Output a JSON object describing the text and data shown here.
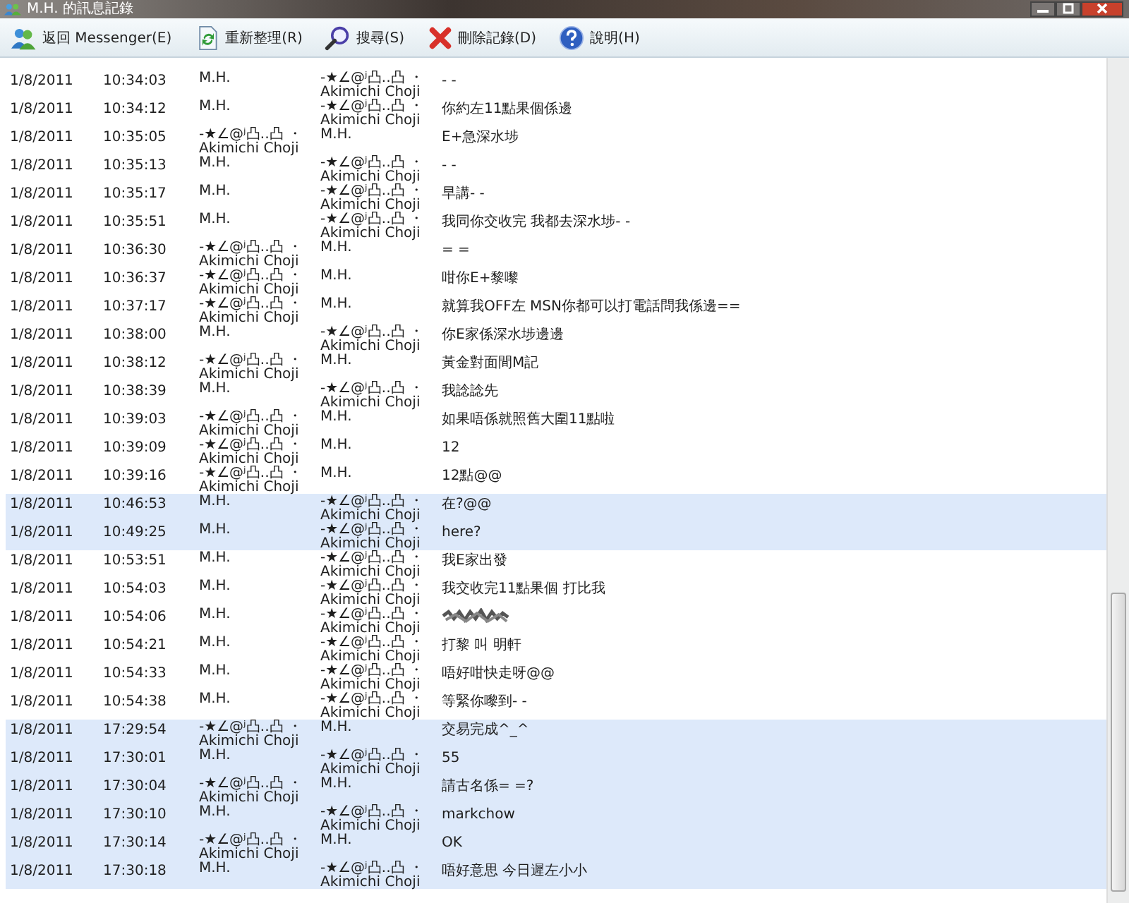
{
  "window": {
    "title": "M.H. 的訊息記錄"
  },
  "toolbar": [
    {
      "kind": "back",
      "label": "返回 Messenger(E)"
    },
    {
      "kind": "refresh",
      "label": "重新整理(R)"
    },
    {
      "kind": "search",
      "label": "搜尋(S)"
    },
    {
      "kind": "delete",
      "label": "刪除記錄(D)"
    },
    {
      "kind": "help",
      "label": "說明(H)"
    }
  ],
  "rows": [
    {
      "date": "1/8/2011",
      "time": "10:34:03",
      "from": "M.H.",
      "to": "-★∠@ʲ凸‥凸 ・ Akimichi Choji",
      "message": "- -",
      "selected": false
    },
    {
      "date": "1/8/2011",
      "time": "10:34:12",
      "from": "M.H.",
      "to": "-★∠@ʲ凸‥凸 ・ Akimichi Choji",
      "message": "你約左11點果個係邊",
      "selected": false
    },
    {
      "date": "1/8/2011",
      "time": "10:35:05",
      "from": "-★∠@ʲ凸‥凸 ・ Akimichi Choji",
      "to": "M.H.",
      "message": "E+急深水埗",
      "selected": false
    },
    {
      "date": "1/8/2011",
      "time": "10:35:13",
      "from": "M.H.",
      "to": "-★∠@ʲ凸‥凸 ・ Akimichi Choji",
      "message": "- -",
      "selected": false
    },
    {
      "date": "1/8/2011",
      "time": "10:35:17",
      "from": "M.H.",
      "to": "-★∠@ʲ凸‥凸 ・ Akimichi Choji",
      "message": "早講- -",
      "selected": false
    },
    {
      "date": "1/8/2011",
      "time": "10:35:51",
      "from": "M.H.",
      "to": "-★∠@ʲ凸‥凸 ・ Akimichi Choji",
      "message": "我同你交收完 我都去深水埗- -",
      "selected": false
    },
    {
      "date": "1/8/2011",
      "time": "10:36:30",
      "from": "-★∠@ʲ凸‥凸 ・ Akimichi Choji",
      "to": "M.H.",
      "message": "= =",
      "selected": false
    },
    {
      "date": "1/8/2011",
      "time": "10:36:37",
      "from": "-★∠@ʲ凸‥凸 ・ Akimichi Choji",
      "to": "M.H.",
      "message": "咁你E+黎嚟",
      "selected": false
    },
    {
      "date": "1/8/2011",
      "time": "10:37:17",
      "from": "-★∠@ʲ凸‥凸 ・ Akimichi Choji",
      "to": "M.H.",
      "message": "就算我OFF左 MSN你都可以打電話問我係邊==",
      "selected": false
    },
    {
      "date": "1/8/2011",
      "time": "10:38:00",
      "from": "M.H.",
      "to": "-★∠@ʲ凸‥凸 ・ Akimichi Choji",
      "message": "你E家係深水埗邊邊",
      "selected": false
    },
    {
      "date": "1/8/2011",
      "time": "10:38:12",
      "from": "-★∠@ʲ凸‥凸 ・ Akimichi Choji",
      "to": "M.H.",
      "message": "黃金對面間M記",
      "selected": false
    },
    {
      "date": "1/8/2011",
      "time": "10:38:39",
      "from": "M.H.",
      "to": "-★∠@ʲ凸‥凸 ・ Akimichi Choji",
      "message": "我諗諗先",
      "selected": false
    },
    {
      "date": "1/8/2011",
      "time": "10:39:03",
      "from": "-★∠@ʲ凸‥凸 ・ Akimichi Choji",
      "to": "M.H.",
      "message": "如果唔係就照舊大圍11點啦",
      "selected": false
    },
    {
      "date": "1/8/2011",
      "time": "10:39:09",
      "from": "-★∠@ʲ凸‥凸 ・ Akimichi Choji",
      "to": "M.H.",
      "message": "12",
      "selected": false
    },
    {
      "date": "1/8/2011",
      "time": "10:39:16",
      "from": "-★∠@ʲ凸‥凸 ・ Akimichi Choji",
      "to": "M.H.",
      "message": "12點@@",
      "selected": false
    },
    {
      "date": "1/8/2011",
      "time": "10:46:53",
      "from": "M.H.",
      "to": "-★∠@ʲ凸‥凸 ・ Akimichi Choji",
      "message": "在?@@",
      "selected": true
    },
    {
      "date": "1/8/2011",
      "time": "10:49:25",
      "from": "M.H.",
      "to": "-★∠@ʲ凸‥凸 ・ Akimichi Choji",
      "message": "here?",
      "selected": true
    },
    {
      "date": "1/8/2011",
      "time": "10:53:51",
      "from": "M.H.",
      "to": "-★∠@ʲ凸‥凸 ・ Akimichi Choji",
      "message": "我E家出發",
      "selected": false
    },
    {
      "date": "1/8/2011",
      "time": "10:54:03",
      "from": "M.H.",
      "to": "-★∠@ʲ凸‥凸 ・ Akimichi Choji",
      "message": "我交收完11點果個 打比我",
      "selected": false
    },
    {
      "date": "1/8/2011",
      "time": "10:54:06",
      "from": "M.H.",
      "to": "-★∠@ʲ凸‥凸 ・ Akimichi Choji",
      "redacted": true,
      "selected": false
    },
    {
      "date": "1/8/2011",
      "time": "10:54:21",
      "from": "M.H.",
      "to": "-★∠@ʲ凸‥凸 ・ Akimichi Choji",
      "message": "打黎 叫 明軒",
      "selected": false
    },
    {
      "date": "1/8/2011",
      "time": "10:54:33",
      "from": "M.H.",
      "to": "-★∠@ʲ凸‥凸 ・ Akimichi Choji",
      "message": "唔好咁快走呀@@",
      "selected": false
    },
    {
      "date": "1/8/2011",
      "time": "10:54:38",
      "from": "M.H.",
      "to": "-★∠@ʲ凸‥凸 ・ Akimichi Choji",
      "message": "等緊你嚟到- -",
      "selected": false
    },
    {
      "date": "1/8/2011",
      "time": "17:29:54",
      "from": "-★∠@ʲ凸‥凸 ・ Akimichi Choji",
      "to": "M.H.",
      "message": "交易完成^_^",
      "selected": true
    },
    {
      "date": "1/8/2011",
      "time": "17:30:01",
      "from": "M.H.",
      "to": "-★∠@ʲ凸‥凸 ・ Akimichi Choji",
      "message": "55",
      "selected": true
    },
    {
      "date": "1/8/2011",
      "time": "17:30:04",
      "from": "-★∠@ʲ凸‥凸 ・ Akimichi Choji",
      "to": "M.H.",
      "message": "請古名係= =?",
      "selected": true
    },
    {
      "date": "1/8/2011",
      "time": "17:30:10",
      "from": "M.H.",
      "to": "-★∠@ʲ凸‥凸 ・ Akimichi Choji",
      "message": "markchow",
      "selected": true
    },
    {
      "date": "1/8/2011",
      "time": "17:30:14",
      "from": "-★∠@ʲ凸‥凸 ・ Akimichi Choji",
      "to": "M.H.",
      "message": "OK",
      "selected": true
    },
    {
      "date": "1/8/2011",
      "time": "17:30:18",
      "from": "M.H.",
      "to": "-★∠@ʲ凸‥凸 ・ Akimichi Choji",
      "message": "唔好意思 今日遲左小小",
      "selected": true
    }
  ]
}
